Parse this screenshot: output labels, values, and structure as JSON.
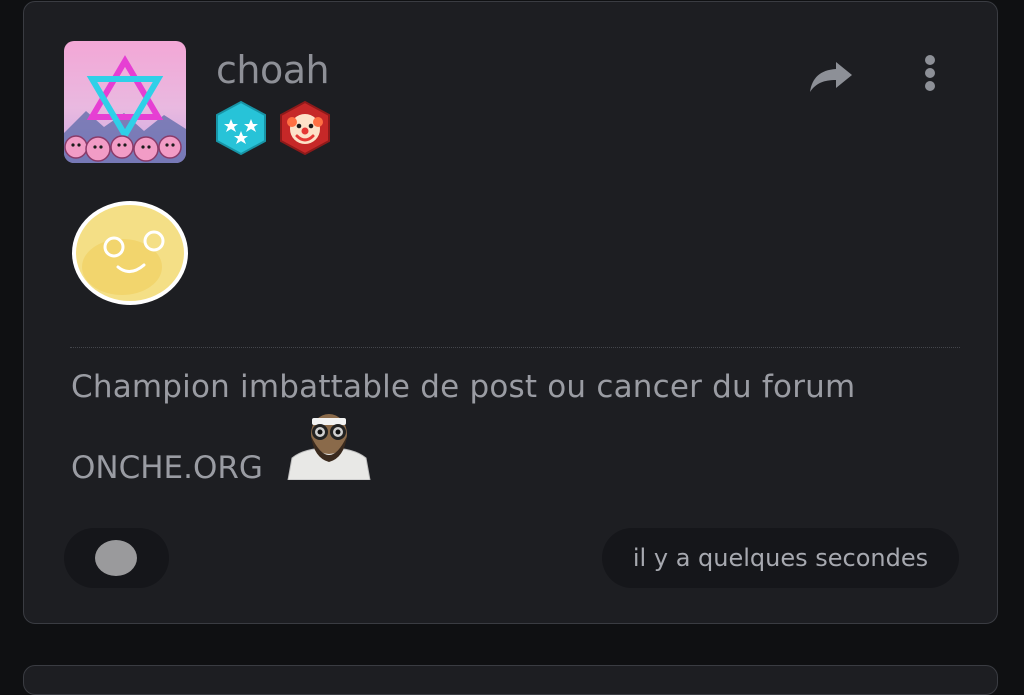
{
  "post": {
    "username": "choah",
    "badges": [
      "stars-badge-icon",
      "clown-badge-icon"
    ],
    "actions": {
      "share": "share-icon",
      "more": "more-vertical-icon"
    },
    "sticker": "smile-face-sticker",
    "signature": {
      "line1": "Champion imbattable de post ou cancer du forum",
      "line2": "ONCHE.ORG"
    },
    "timestamp": "il y a quelques secondes"
  },
  "colors": {
    "background": "#0f1012",
    "card": "#1d1e22",
    "card_border": "#3a3c42",
    "text_muted": "#8e9097",
    "pill_bg": "#15161a",
    "badge_cyan": "#27c3d8",
    "badge_red": "#c62828",
    "sticker_yellow": "#f4df86"
  }
}
